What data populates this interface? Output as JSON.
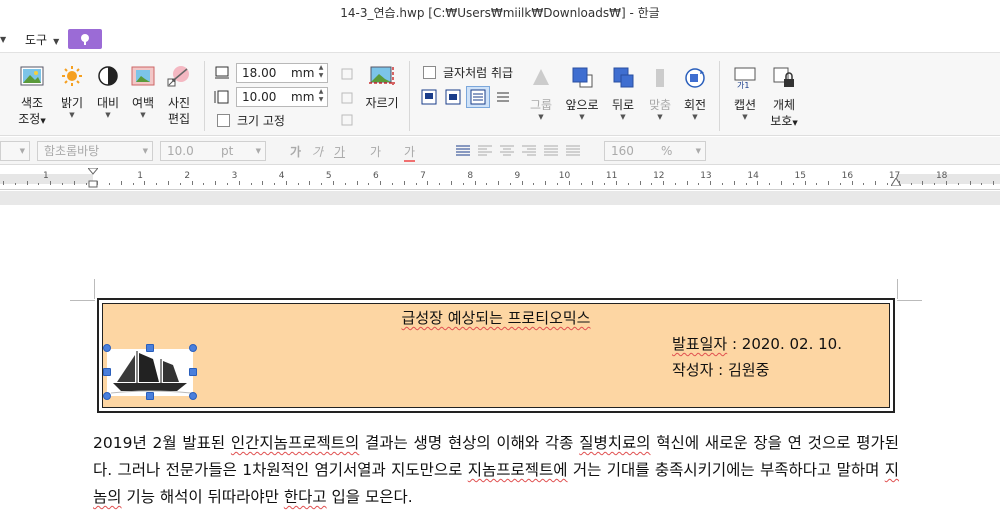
{
  "window": {
    "title": "14-3_연습.hwp [C:₩Users₩miilk₩Downloads₩] - 한글"
  },
  "menu": {
    "tools_label": "도구"
  },
  "ribbon": {
    "color_adjust": [
      "색조",
      "조정"
    ],
    "brightness": "밝기",
    "contrast": "대비",
    "margin": "여백",
    "photo_edit": [
      "사진",
      "편집"
    ],
    "width_value": "18.00",
    "height_value": "10.00",
    "unit": "mm",
    "fix_size_label": "크기 고정",
    "crop_label": "자르기",
    "treat_as_char_label": "글자처럼 취급",
    "group_label": "그룹",
    "bring_front_label": "앞으로",
    "send_back_label": "뒤로",
    "align_label": "맞춤",
    "rotate_label": "회전",
    "caption_label": "캡션",
    "object_protect": [
      "개체",
      "보호"
    ]
  },
  "formatbar": {
    "font_name": "함초롬바탕",
    "font_size": "10.0",
    "size_unit": "pt",
    "zoom": "160",
    "zoom_unit": "%"
  },
  "ruler": {
    "numbers": [
      "1",
      "1",
      "2",
      "3",
      "4",
      "5",
      "6",
      "7",
      "8",
      "9",
      "10",
      "11",
      "12",
      "13",
      "14",
      "15",
      "16",
      "17",
      "18"
    ]
  },
  "document": {
    "header_title": "급성장 예상되는 프로티오믹스",
    "date_label": "발표일자",
    "date_value": "2020. 02. 10.",
    "author_label": "작성자",
    "author_value": "김원중",
    "paragraph": {
      "p1": "2019년 2월 발표된 ",
      "w1": "인간지놈프로젝트의",
      "p2": " 결과는 생명 현상의 이해와 각종 ",
      "w2": "질병치료의",
      "p3": " 혁신에 새로운 장을 연 것으로 평가된다. 그러나 전문가들은 1차원적인 염기서열과 지도만으로 ",
      "w3": "지놈프로젝트에",
      "p4": " 거는 기대를 충족시키기에는 부족하다고 말하며 ",
      "w4": "지놈의",
      "p5": " 기능 해석이 뒤따라야만 ",
      "w5": "한다고",
      "p6": " 입을 모은다."
    }
  },
  "colors": {
    "header_fill": "#fdd6a3",
    "selection_handle": "#4a7fdc",
    "menu_accent": "#9b6bd6"
  }
}
